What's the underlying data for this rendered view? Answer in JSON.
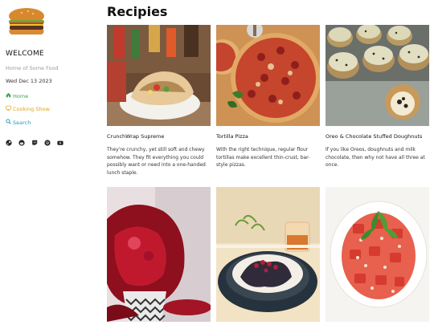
{
  "sidebar": {
    "logo_icon": "burger-icon",
    "welcome": "WELCOME",
    "tagline": "Home of Some Food",
    "date": "Wed Dec 13 2023",
    "nav": [
      {
        "label": "Home",
        "icon": "home-icon",
        "color": "#3aa35a"
      },
      {
        "label": "Cooking Show",
        "icon": "tv-icon",
        "color": "#e0a21a"
      },
      {
        "label": "Search",
        "icon": "search-icon",
        "color": "#1f9bb0"
      }
    ],
    "socials": [
      "steam-icon",
      "reddit-icon",
      "twitch-icon",
      "spotify-icon",
      "youtube-icon"
    ]
  },
  "main": {
    "title": "Recipies",
    "recipes": [
      {
        "title": "CrunchWrap Supreme",
        "description": "They're crunchy, yet still soft and chewy somehow. They fit everything you could possibly want or need into a one-handed lunch staple.",
        "image": "crunchwrap-photo"
      },
      {
        "title": "Tortilla Pizza",
        "description": "With the right technique, regular flour tortillas make excellent thin-crust, bar-style pizzas.",
        "image": "pizza-photo"
      },
      {
        "title": "Oreo & Chocolate Stuffed Doughnuts",
        "description": "If you like Oreos, doughnuts and milk chocolate, then why not have all three at once.",
        "image": "doughnuts-photo"
      },
      {
        "title": "",
        "description": "",
        "image": "cherry-dessert-photo"
      },
      {
        "title": "",
        "description": "",
        "image": "plated-dessert-photo"
      },
      {
        "title": "",
        "description": "",
        "image": "watermelon-salad-photo"
      }
    ]
  }
}
